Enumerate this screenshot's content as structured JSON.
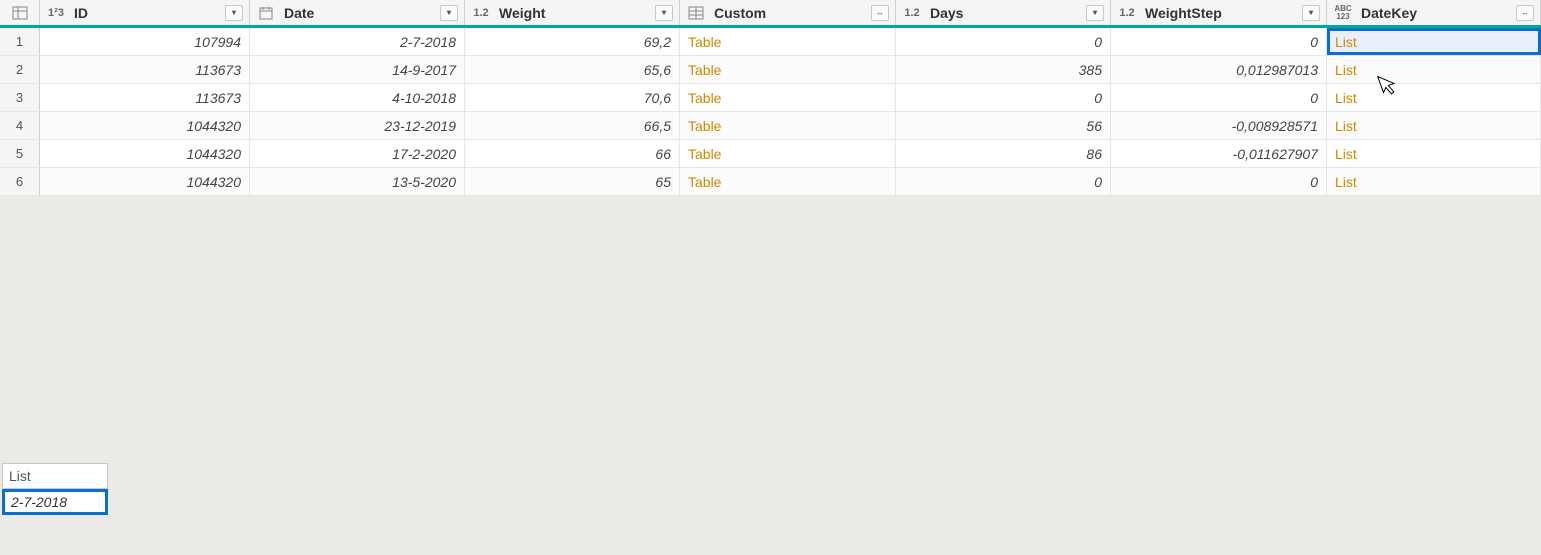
{
  "columns": [
    {
      "name": "ID",
      "type": "int",
      "typeLabel": "1²3",
      "align": "right",
      "button": "filter"
    },
    {
      "name": "Date",
      "type": "date",
      "typeLabel": "📅",
      "align": "right",
      "button": "filter"
    },
    {
      "name": "Weight",
      "type": "dec",
      "typeLabel": "1.2",
      "align": "right",
      "button": "filter"
    },
    {
      "name": "Custom",
      "type": "table",
      "typeLabel": "▦",
      "align": "left",
      "button": "expand"
    },
    {
      "name": "Days",
      "type": "dec",
      "typeLabel": "1.2",
      "align": "right",
      "button": "filter"
    },
    {
      "name": "WeightStep",
      "type": "dec",
      "typeLabel": "1.2",
      "align": "right",
      "button": "filter"
    },
    {
      "name": "DateKey",
      "type": "any",
      "typeLabel": "ABC123",
      "align": "left",
      "button": "expand"
    }
  ],
  "rows": [
    {
      "ID": "107994",
      "Date": "2-7-2018",
      "Weight": "69,2",
      "Custom": "Table",
      "Days": "0",
      "WeightStep": "0",
      "DateKey": "List"
    },
    {
      "ID": "113673",
      "Date": "14-9-2017",
      "Weight": "65,6",
      "Custom": "Table",
      "Days": "385",
      "WeightStep": "0,012987013",
      "DateKey": "List"
    },
    {
      "ID": "113673",
      "Date": "4-10-2018",
      "Weight": "70,6",
      "Custom": "Table",
      "Days": "0",
      "WeightStep": "0",
      "DateKey": "List"
    },
    {
      "ID": "1044320",
      "Date": "23-12-2019",
      "Weight": "66,5",
      "Custom": "Table",
      "Days": "56",
      "WeightStep": "-0,008928571",
      "DateKey": "List"
    },
    {
      "ID": "1044320",
      "Date": "17-2-2020",
      "Weight": "66",
      "Custom": "Table",
      "Days": "86",
      "WeightStep": "-0,011627907",
      "DateKey": "List"
    },
    {
      "ID": "1044320",
      "Date": "13-5-2020",
      "Weight": "65",
      "Custom": "Table",
      "Days": "0",
      "WeightStep": "0",
      "DateKey": "List"
    }
  ],
  "selected": {
    "row": 0,
    "col": "DateKey"
  },
  "preview": {
    "header": "List",
    "value": "2-7-2018"
  }
}
